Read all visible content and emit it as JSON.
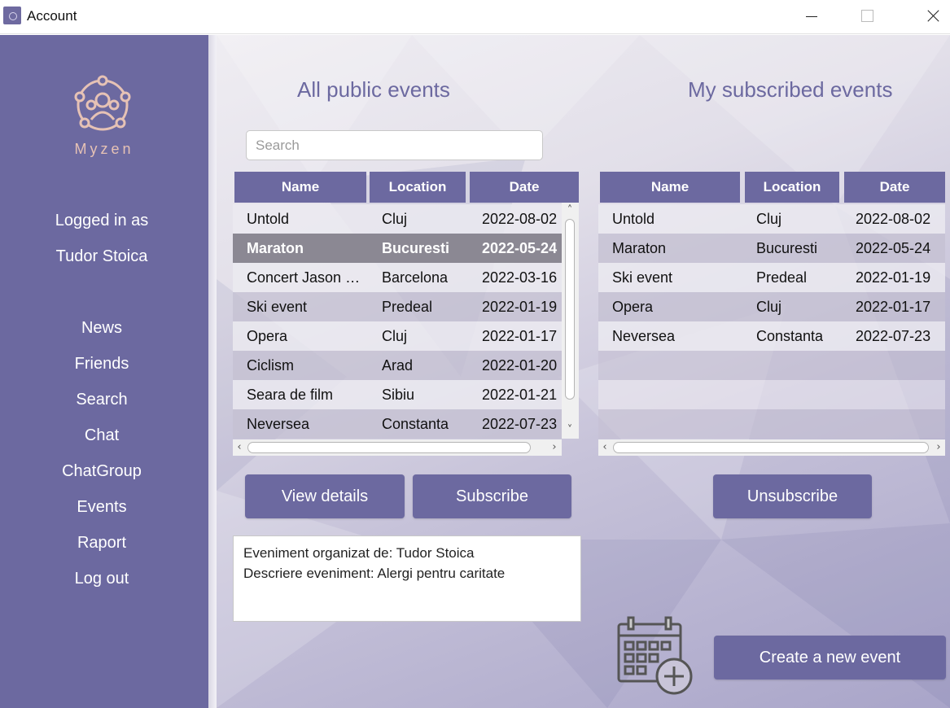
{
  "window": {
    "title": "Account",
    "app_icon": "app-icon",
    "controls": [
      "minimize",
      "maximize",
      "close"
    ]
  },
  "sidebar": {
    "logo_text": "Myzen",
    "logged_in_label": "Logged in as",
    "username": "Tudor Stoica",
    "nav": [
      "News",
      "Friends",
      "Search",
      "Chat",
      "ChatGroup",
      "Events",
      "Raport",
      "Log out"
    ]
  },
  "public_events": {
    "heading": "All public events",
    "search_placeholder": "Search",
    "columns": [
      "Name",
      "Location",
      "Date"
    ],
    "selected_index": 1,
    "rows": [
      [
        "Untold",
        "Cluj",
        "2022-08-02"
      ],
      [
        "Maraton",
        "Bucuresti",
        "2022-05-24"
      ],
      [
        "Concert Jason D...",
        "Barcelona",
        "2022-03-16"
      ],
      [
        "Ski event",
        "Predeal",
        "2022-01-19"
      ],
      [
        "Opera",
        "Cluj",
        "2022-01-17"
      ],
      [
        "Ciclism",
        "Arad",
        "2022-01-20"
      ],
      [
        "Seara de film",
        "Sibiu",
        "2022-01-21"
      ],
      [
        "Neversea",
        "Constanta",
        "2022-07-23"
      ]
    ]
  },
  "subscribed_events": {
    "heading": "My subscribed events",
    "columns": [
      "Name",
      "Location",
      "Date"
    ],
    "rows": [
      [
        "Untold",
        "Cluj",
        "2022-08-02"
      ],
      [
        "Maraton",
        "Bucuresti",
        "2022-05-24"
      ],
      [
        "Ski event",
        "Predeal",
        "2022-01-19"
      ],
      [
        "Opera",
        "Cluj",
        "2022-01-17"
      ],
      [
        "Neversea",
        "Constanta",
        "2022-07-23"
      ]
    ]
  },
  "buttons": {
    "view_details": "View details",
    "subscribe": "Subscribe",
    "unsubscribe": "Unsubscribe",
    "create_event": "Create a new event"
  },
  "details": {
    "line1": "Eveniment organizat de: Tudor Stoica",
    "line2": "Descriere eveniment: Alergi pentru caritate"
  },
  "colors": {
    "accent": "#6c69a0",
    "logo": "#e6c2b5",
    "selected_row": "#8b8893"
  }
}
